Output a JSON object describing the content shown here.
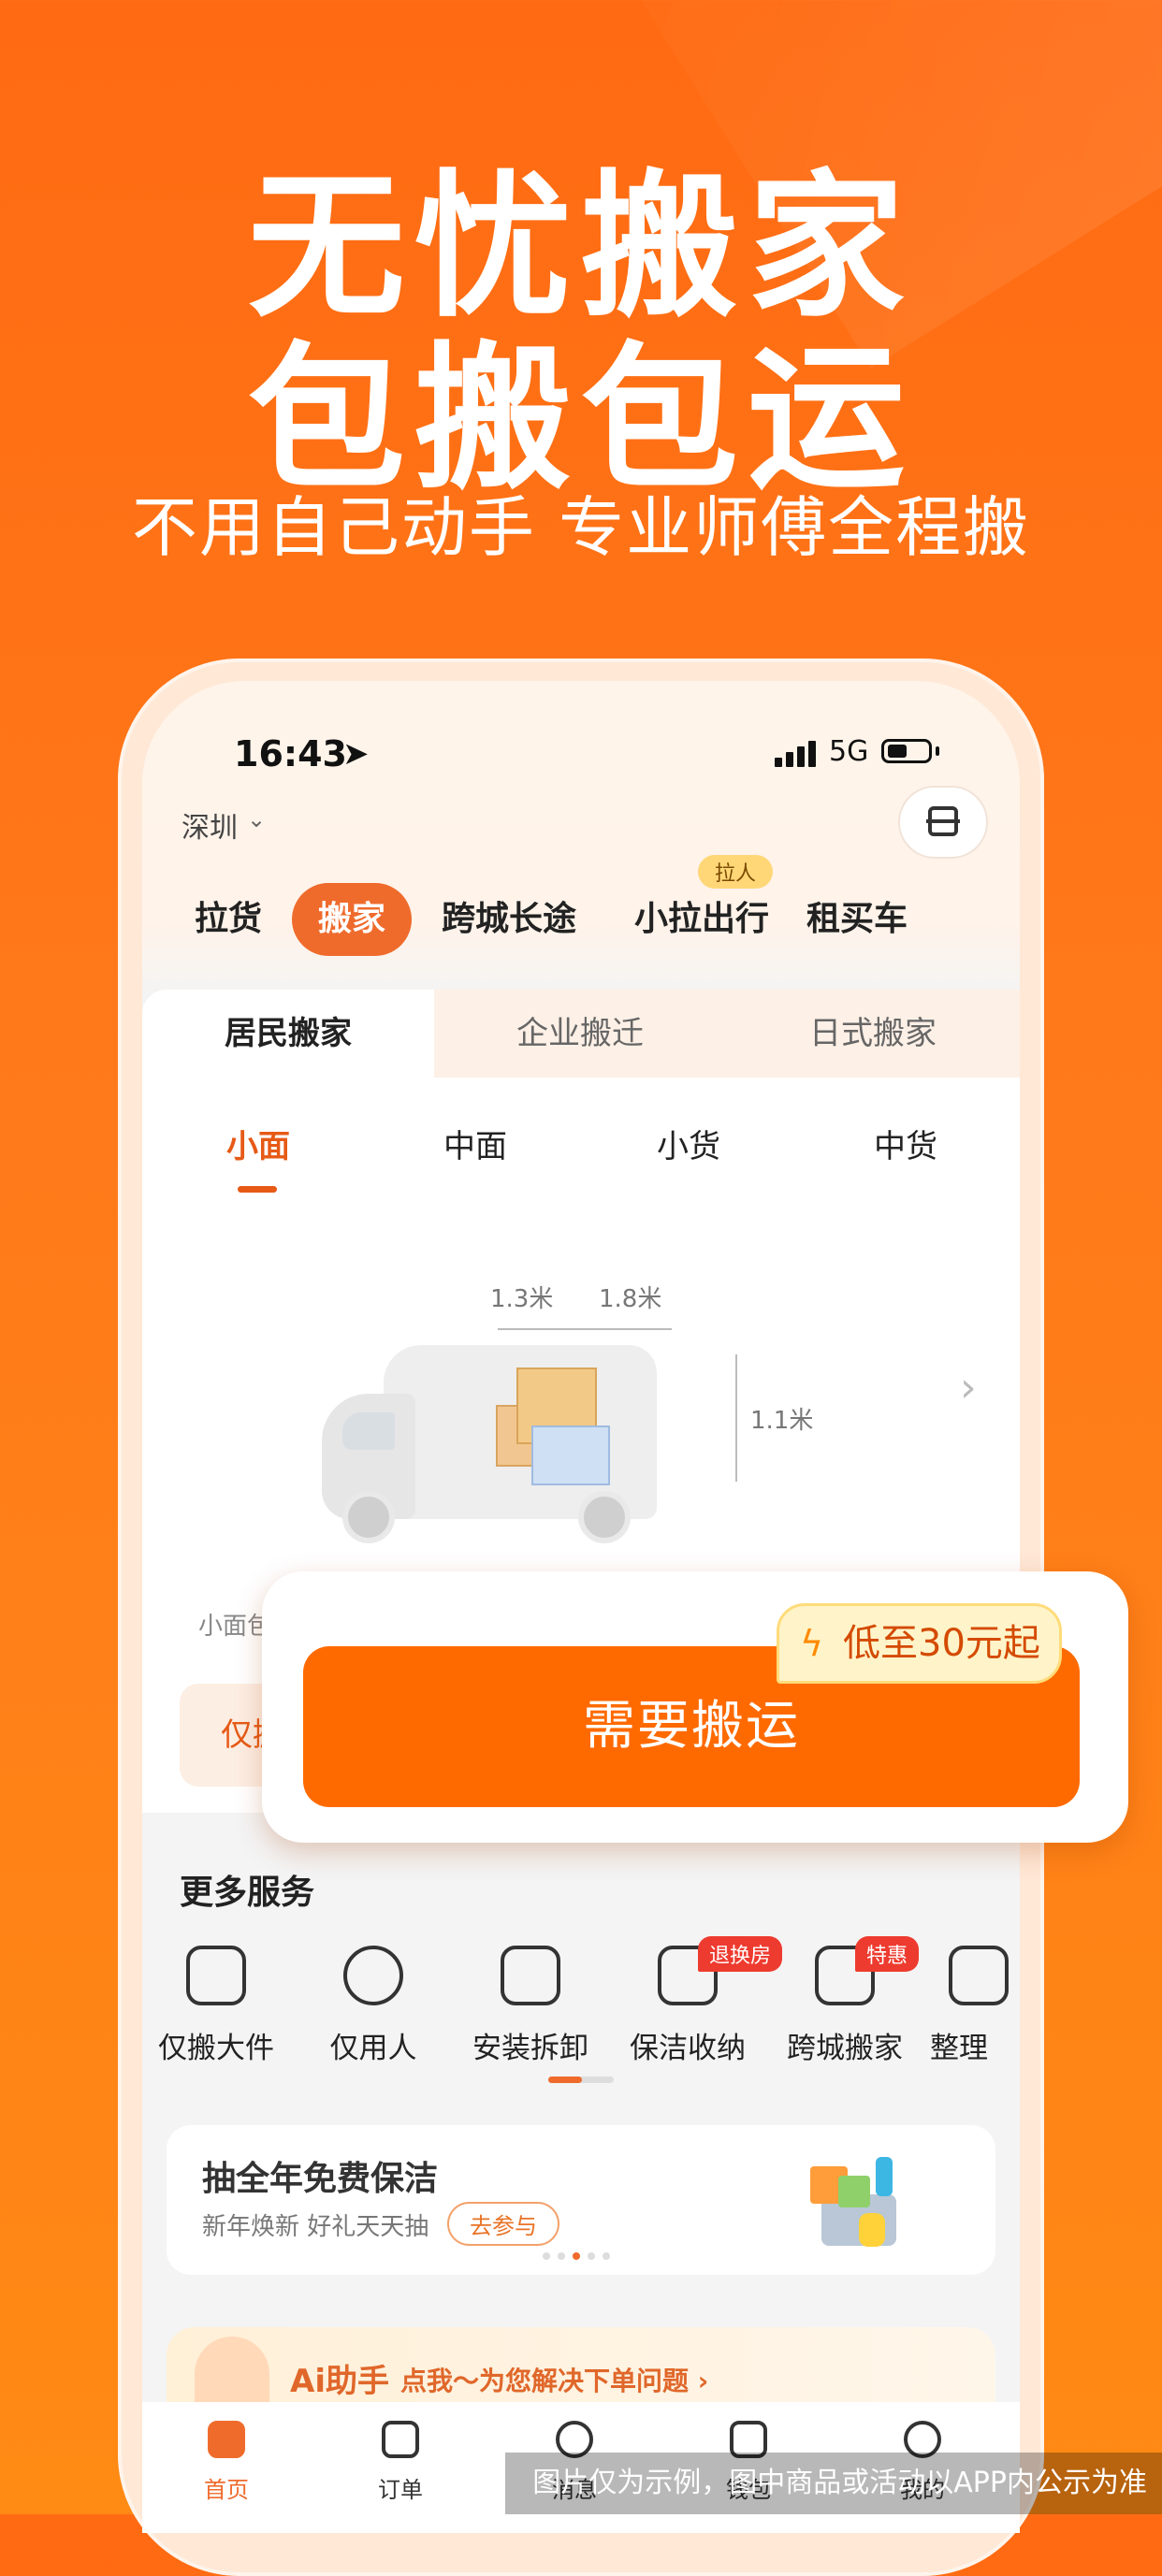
{
  "hero": {
    "line1": "无忧搬家",
    "line2": "包搬包运",
    "subtitle": "不用自己动手 专业师傅全程搬"
  },
  "status_bar": {
    "time": "16:43",
    "network": "5G"
  },
  "location": {
    "city": "深圳"
  },
  "biz_tabs": [
    {
      "label": "拉货"
    },
    {
      "label": "搬家",
      "active": true
    },
    {
      "label": "跨城长途"
    },
    {
      "label": "小拉出行",
      "badge": "拉人"
    },
    {
      "label": "租买车"
    }
  ],
  "sub_tabs": [
    "居民搬家",
    "企业搬迁",
    "日式搬家"
  ],
  "vehicle_tabs": [
    "小面",
    "中面",
    "小货",
    "中货"
  ],
  "vehicle": {
    "dim_width": "1.3米",
    "dim_length": "1.8米",
    "dim_height": "1.1米",
    "note_prefix": "小面包",
    "side_btn": "仅搬"
  },
  "cta": {
    "label": "需要搬运",
    "promo": "低至30元起"
  },
  "more_services": {
    "title": "更多服务",
    "items": [
      {
        "label": "仅搬大件",
        "icon": "sofa-icon"
      },
      {
        "label": "仅用人",
        "icon": "person-icon"
      },
      {
        "label": "安装拆卸",
        "icon": "tools-icon"
      },
      {
        "label": "保洁收纳",
        "icon": "broom-icon",
        "badge": "退换房"
      },
      {
        "label": "跨城搬家",
        "icon": "clipboard-icon",
        "badge": "特惠"
      },
      {
        "label": "整理",
        "icon": "box-icon"
      }
    ]
  },
  "banner": {
    "title": "抽全年免费保洁",
    "subtitle": "新年焕新 好礼天天抽",
    "button": "去参与"
  },
  "ai": {
    "title": "Ai助手",
    "text": "点我～为您解决下单问题 ›"
  },
  "bottom_nav": [
    {
      "label": "首页",
      "active": true
    },
    {
      "label": "订单"
    },
    {
      "label": "消息"
    },
    {
      "label": "钱包"
    },
    {
      "label": "我的"
    }
  ],
  "disclaimer": "图片仅为示例，图中商品或活动以APP内公示为准",
  "colors": {
    "brand": "#ff6a00",
    "accent": "#ef6b2c"
  }
}
